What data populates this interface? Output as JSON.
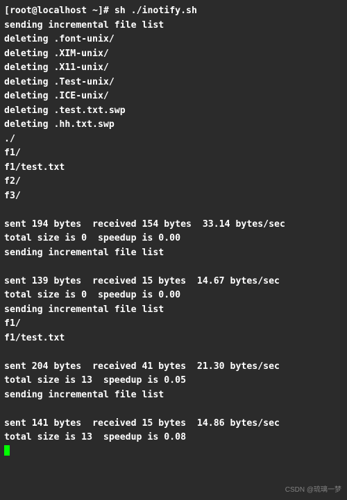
{
  "prompt": {
    "user_host": "[root@localhost ~]#",
    "command": "sh ./inotify.sh"
  },
  "lines": [
    "sending incremental file list",
    "deleting .font-unix/",
    "deleting .XIM-unix/",
    "deleting .X11-unix/",
    "deleting .Test-unix/",
    "deleting .ICE-unix/",
    "deleting .test.txt.swp",
    "deleting .hh.txt.swp",
    "./",
    "f1/",
    "f1/test.txt",
    "f2/",
    "f3/",
    "",
    "sent 194 bytes  received 154 bytes  33.14 bytes/sec",
    "total size is 0  speedup is 0.00",
    "sending incremental file list",
    "",
    "sent 139 bytes  received 15 bytes  14.67 bytes/sec",
    "total size is 0  speedup is 0.00",
    "sending incremental file list",
    "f1/",
    "f1/test.txt",
    "",
    "sent 204 bytes  received 41 bytes  21.30 bytes/sec",
    "total size is 13  speedup is 0.05",
    "sending incremental file list",
    "",
    "sent 141 bytes  received 15 bytes  14.86 bytes/sec",
    "total size is 13  speedup is 0.08"
  ],
  "watermark": "CSDN @琉璃一梦"
}
